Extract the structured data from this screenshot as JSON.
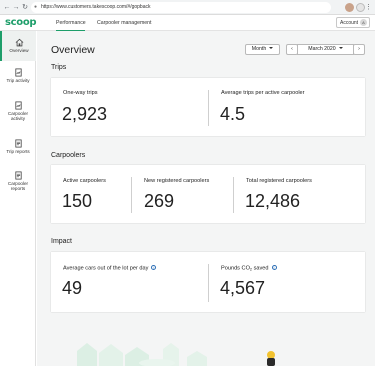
{
  "browser": {
    "url": "https://www.customers.takescoop.com/#/gopback"
  },
  "app": {
    "logo": "scoop",
    "tabs": [
      "Performance",
      "Carpooler management"
    ],
    "account_label": "Account",
    "account_initial": "A"
  },
  "sidebar": {
    "items": [
      {
        "label": "Overview",
        "icon": "home-icon"
      },
      {
        "label": "Trip activity",
        "icon": "trip-activity-icon"
      },
      {
        "label": "Carpooler activity",
        "icon": "carpooler-activity-icon"
      },
      {
        "label": "Trip reports",
        "icon": "trip-reports-icon"
      },
      {
        "label": "Carpooler reports",
        "icon": "carpooler-reports-icon"
      }
    ]
  },
  "main": {
    "title": "Overview",
    "period_select": "Month",
    "period_value": "March 2020",
    "sections": {
      "trips": {
        "heading": "Trips",
        "stats": [
          {
            "label": "One-way trips",
            "value": "2,923"
          },
          {
            "label": "Average trips per active carpooler",
            "value": "4.5"
          }
        ]
      },
      "carpoolers": {
        "heading": "Carpoolers",
        "stats": [
          {
            "label": "Active carpoolers",
            "value": "150"
          },
          {
            "label": "New registered carpoolers",
            "value": "269"
          },
          {
            "label": "Total registered carpoolers",
            "value": "12,486"
          }
        ]
      },
      "impact": {
        "heading": "Impact",
        "stats": [
          {
            "label": "Average cars out of the lot per day",
            "value": "49"
          },
          {
            "label_pre": "Pounds CO",
            "label_sub": "2",
            "label_post": " saved",
            "value": "4,567"
          }
        ]
      }
    }
  },
  "colors": {
    "brand_green": "#1e9e6a",
    "info_blue": "#2d6fb6",
    "page_bg": "#f4f5f5"
  }
}
